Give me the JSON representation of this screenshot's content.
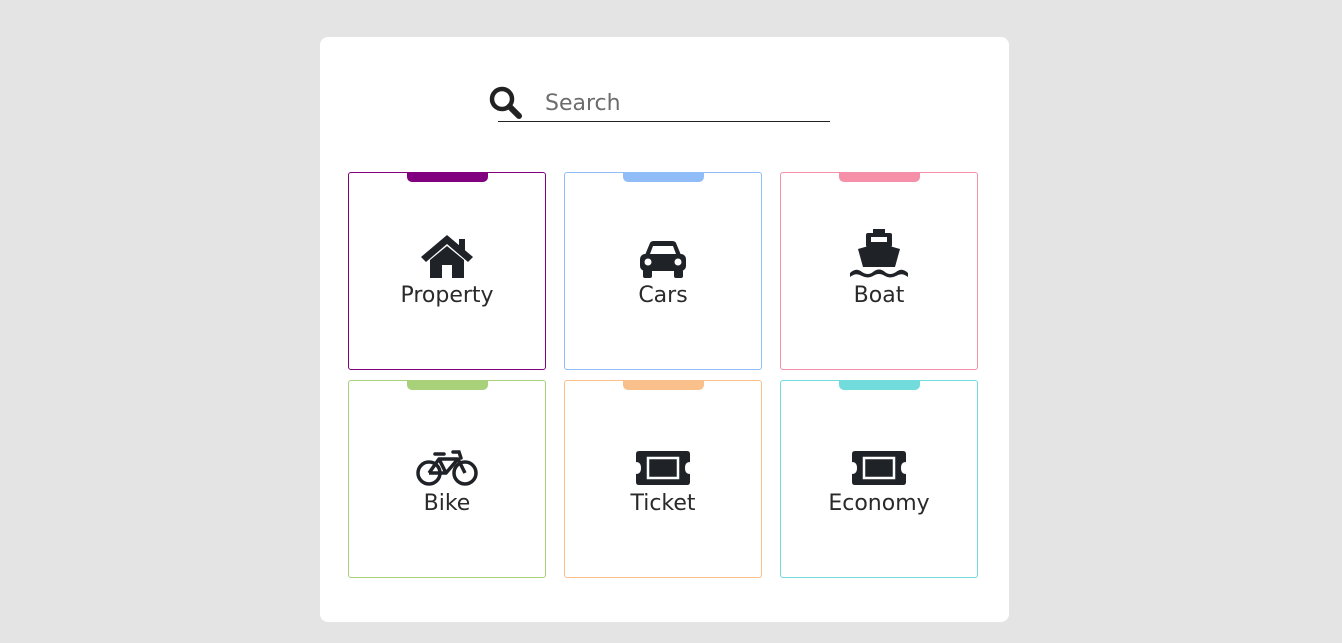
{
  "search": {
    "placeholder": "Search",
    "icon": "search-icon"
  },
  "categories": [
    {
      "label": "Property",
      "icon": "house-icon",
      "color": "#800080"
    },
    {
      "label": "Cars",
      "icon": "car-icon",
      "color": "#90bdf7"
    },
    {
      "label": "Boat",
      "icon": "ship-icon",
      "color": "#f690a8"
    },
    {
      "label": "Bike",
      "icon": "bicycle-icon",
      "color": "#a8d17a"
    },
    {
      "label": "Ticket",
      "icon": "ticket-icon",
      "color": "#f9c08c"
    },
    {
      "label": "Economy",
      "icon": "ticket-icon",
      "color": "#72dcdc"
    }
  ]
}
